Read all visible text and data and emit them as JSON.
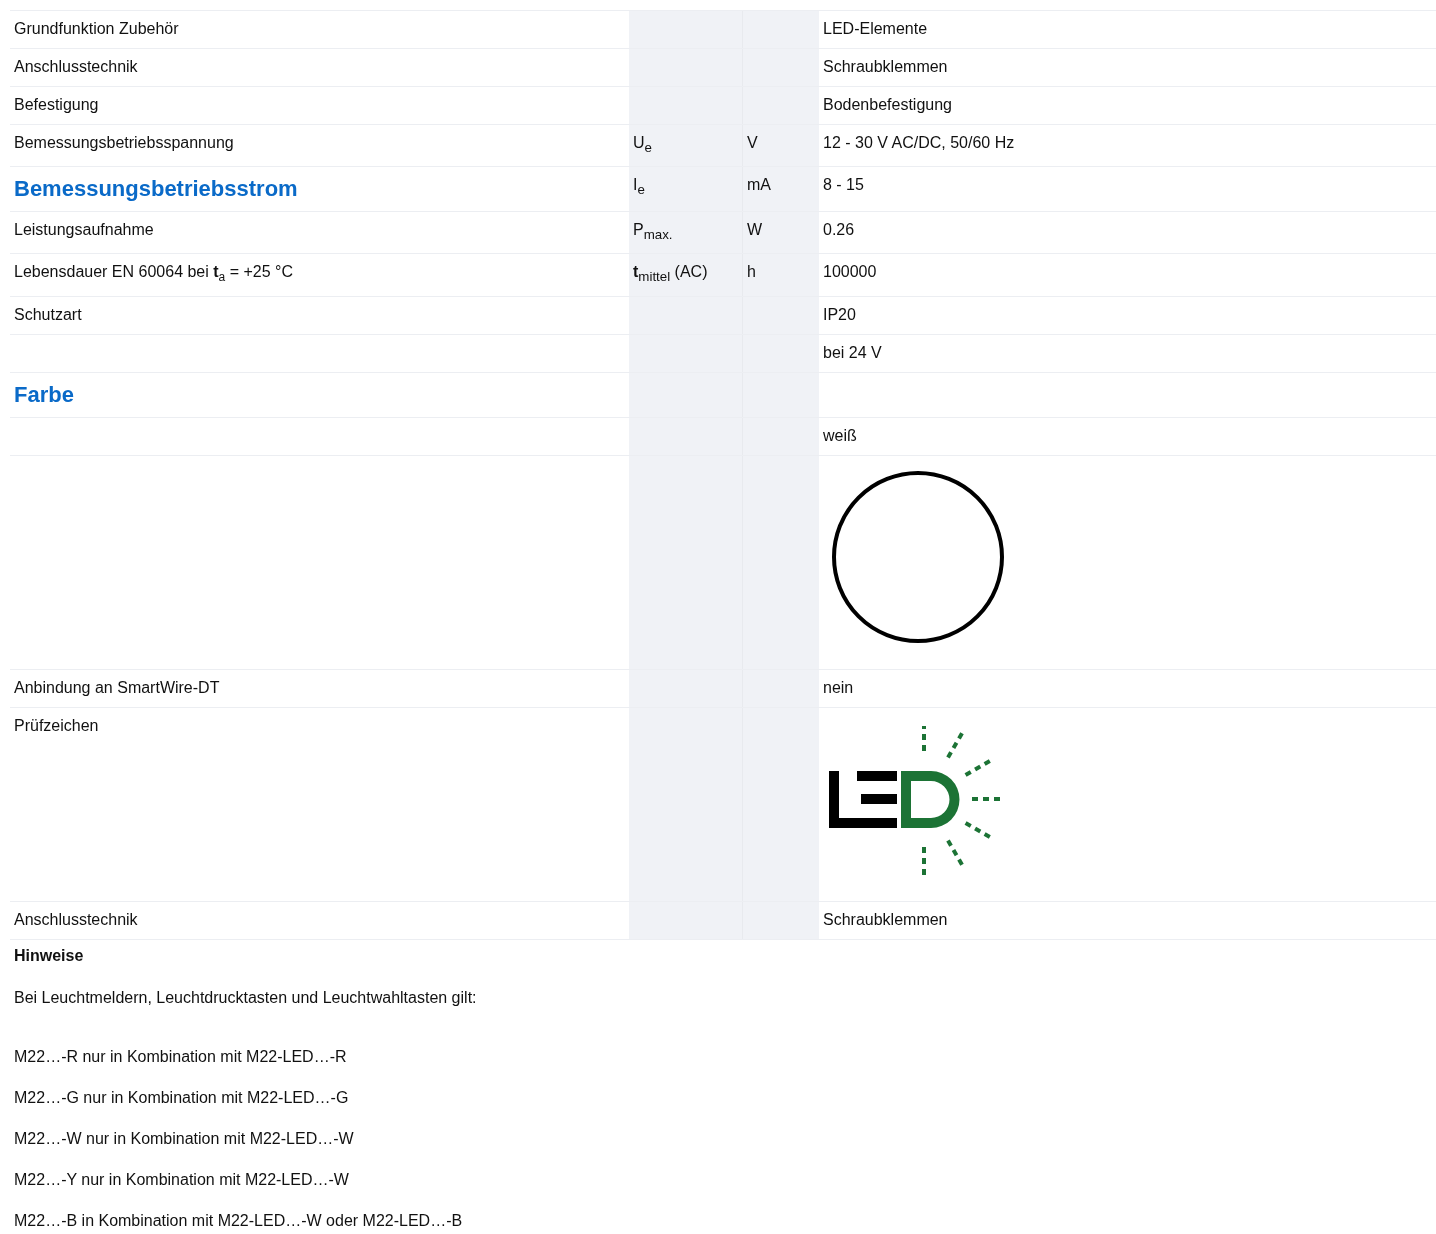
{
  "table": {
    "rows": [
      {
        "kind": "text",
        "label": "Grundfunktion Zubehör",
        "value": "LED-Elemente"
      },
      {
        "kind": "text",
        "label": "Anschlusstechnik",
        "value": "Schraubklemmen"
      },
      {
        "kind": "text",
        "label": "Befestigung",
        "value": "Bodenbefestigung"
      },
      {
        "kind": "text",
        "label": "Bemessungsbetriebsspannung",
        "symbol": "U$_{e}$",
        "unit": "V",
        "value": "12 - 30 V AC/DC, 50/60 Hz"
      },
      {
        "kind": "heading",
        "label": "Bemessungsbetriebsstrom",
        "symbol": "I$_{e}$",
        "unit": "mA",
        "value": "8 - 15"
      },
      {
        "kind": "text",
        "label": "Leistungsaufnahme",
        "symbol": "P$_{max.}$",
        "unit": "W",
        "value": "0.26"
      },
      {
        "kind": "text",
        "label": "Lebensdauer EN 60064 bei **t**$_{a}$ = +25 °C",
        "symbol": "**t**$_{mittel}$ (AC)",
        "unit": "h",
        "value": "100000"
      },
      {
        "kind": "text",
        "label": "Schutzart",
        "value": "IP20"
      },
      {
        "kind": "text",
        "value": "bei 24 V"
      },
      {
        "kind": "heading",
        "label": "Farbe"
      },
      {
        "kind": "text",
        "value": "weiß"
      },
      {
        "kind": "color-circle"
      },
      {
        "kind": "text",
        "label": "Anbindung an SmartWire-DT",
        "value": "nein"
      },
      {
        "kind": "led-logo",
        "label": "Prüfzeichen"
      },
      {
        "kind": "text",
        "label": "Anschlusstechnik",
        "value": "Schraubklemmen"
      }
    ]
  },
  "notes": {
    "title": "Hinweise",
    "intro": "Bei Leuchtmeldern, Leuchtdrucktasten und Leuchtwahltasten gilt:",
    "lines": [
      "M22…-R nur in Kombination mit M22-LED…-R",
      "M22…-G nur in Kombination mit M22-LED…-G",
      "M22…-W nur in Kombination mit M22-LED…-W",
      "M22…-Y nur in Kombination mit M22-LED…-W",
      "M22…-B in Kombination mit M22-LED…-W oder M22-LED…-B"
    ]
  }
}
